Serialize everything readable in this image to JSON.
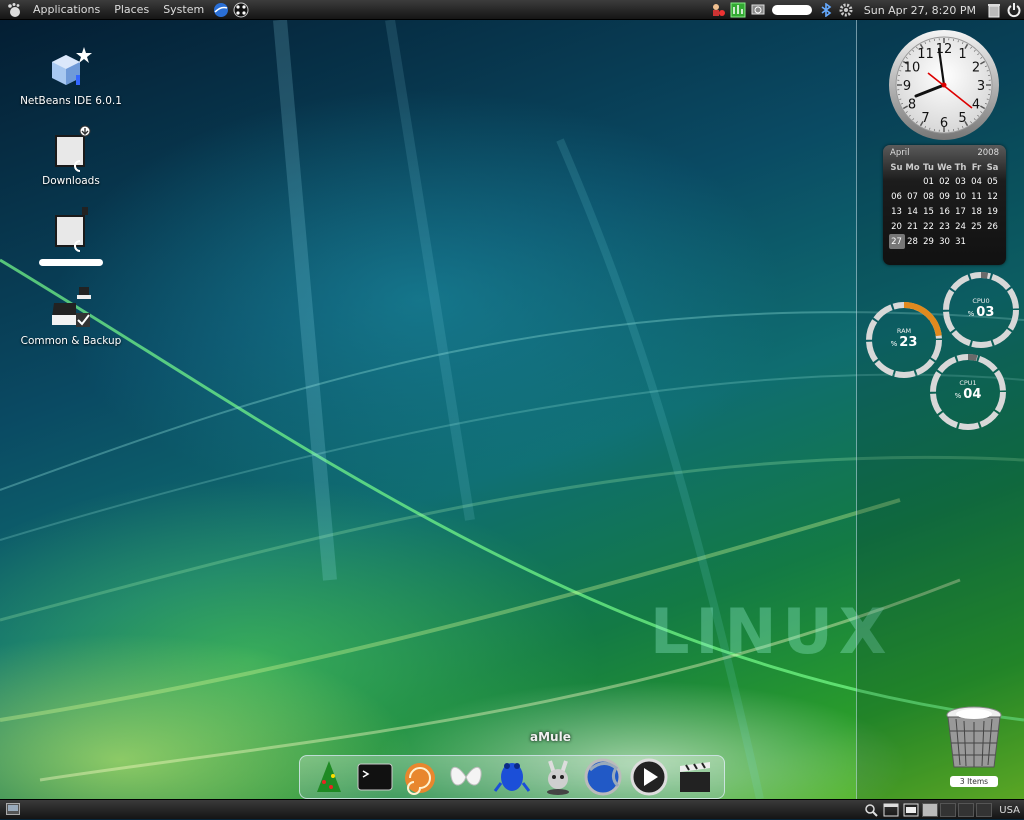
{
  "top_panel": {
    "menus": [
      "Applications",
      "Places",
      "System"
    ],
    "datetime": "Sun Apr 27,  8:20 PM"
  },
  "desktop_icons": [
    {
      "label": "NetBeans IDE 6.0.1",
      "icon": "netbeans-icon"
    },
    {
      "label": "Downloads",
      "icon": "downloads-folder-icon"
    },
    {
      "label": "",
      "icon": "folder-icon"
    },
    {
      "label": "Common & Backup",
      "icon": "backup-folder-icon"
    }
  ],
  "wallpaper_text": "LINUX",
  "clock_widget": {
    "numbers": [
      "12",
      "1",
      "2",
      "3",
      "4",
      "5",
      "6",
      "7",
      "8",
      "9",
      "10",
      "11"
    ],
    "time": "8:20"
  },
  "calendar": {
    "month": "April",
    "year": "2008",
    "weekdays": [
      "Su",
      "Mo",
      "Tu",
      "We",
      "Th",
      "Fr",
      "Sa"
    ],
    "weeks": [
      [
        "",
        "",
        "01",
        "02",
        "03",
        "04",
        "05"
      ],
      [
        "06",
        "07",
        "08",
        "09",
        "10",
        "11",
        "12"
      ],
      [
        "13",
        "14",
        "15",
        "16",
        "17",
        "18",
        "19"
      ],
      [
        "20",
        "21",
        "22",
        "23",
        "24",
        "25",
        "26"
      ],
      [
        "27",
        "28",
        "29",
        "30",
        "31",
        "",
        ""
      ]
    ],
    "today": "27"
  },
  "gauges": {
    "cpu0": {
      "label": "CPU0",
      "value": "03",
      "percent": 3
    },
    "ram": {
      "label": "RAM",
      "value": "23",
      "percent": 23
    },
    "cpu1": {
      "label": "CPU1",
      "value": "04",
      "percent": 4
    },
    "unit": "%"
  },
  "trash": {
    "badge": "3 Items"
  },
  "dock": {
    "tooltip": "aMule",
    "items": [
      "tree-icon",
      "terminal-icon",
      "shell-icon",
      "butterfly-icon",
      "frog-icon",
      "amule-icon",
      "browser-icon",
      "media-player-icon",
      "clapperboard-icon"
    ]
  },
  "bottom_panel": {
    "keyboard_layout": "USA"
  },
  "colors": {
    "ram_gauge": "#e08a1e",
    "gauge_track": "#d8d8d8",
    "panel": "#1e1e1e"
  }
}
